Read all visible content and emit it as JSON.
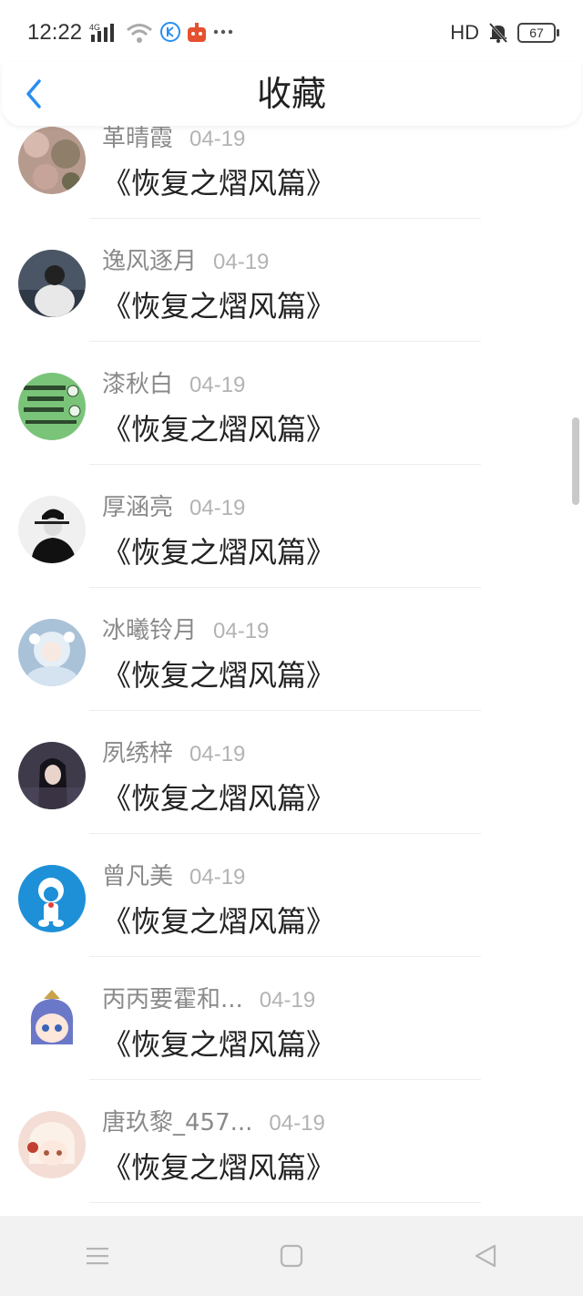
{
  "status_bar": {
    "time": "12:22",
    "network": "4G",
    "hd": "HD",
    "battery": "67"
  },
  "header": {
    "title": "收藏"
  },
  "items": [
    {
      "name": "革晴霞",
      "date": "04-19",
      "title": "《恢复之熠风篇》",
      "avatar_color": "#b79a8e"
    },
    {
      "name": "逸风逐月",
      "date": "04-19",
      "title": "《恢复之熠风篇》",
      "avatar_color": "#4a5566"
    },
    {
      "name": "漆秋白",
      "date": "04-19",
      "title": "《恢复之熠风篇》",
      "avatar_color": "#7ac47a"
    },
    {
      "name": "厚涵亮",
      "date": "04-19",
      "title": "《恢复之熠风篇》",
      "avatar_color": "#e8e8e8"
    },
    {
      "name": "冰曦铃月",
      "date": "04-19",
      "title": "《恢复之熠风篇》",
      "avatar_color": "#a9c2d8"
    },
    {
      "name": "夙绣梓",
      "date": "04-19",
      "title": "《恢复之熠风篇》",
      "avatar_color": "#3e3a4a"
    },
    {
      "name": "曾凡美",
      "date": "04-19",
      "title": "《恢复之熠风篇》",
      "avatar_color": "#1e90d8"
    },
    {
      "name": "丙丙要霍和...",
      "date": "04-19",
      "title": "《恢复之熠风篇》",
      "avatar_color": "#9fb7e0"
    },
    {
      "name": "唐玖黎_457...",
      "date": "04-19",
      "title": "《恢复之熠风篇》",
      "avatar_color": "#f3ddd4"
    }
  ],
  "colors": {
    "accent": "#2a8ef0",
    "name_text": "#8a8a8a",
    "date_text": "#b3b3b3",
    "title_text": "#222222"
  },
  "icons": {
    "back": "chevron-left-icon",
    "menu": "menu-icon",
    "home": "square-home-icon",
    "back_nav": "triangle-back-icon"
  }
}
